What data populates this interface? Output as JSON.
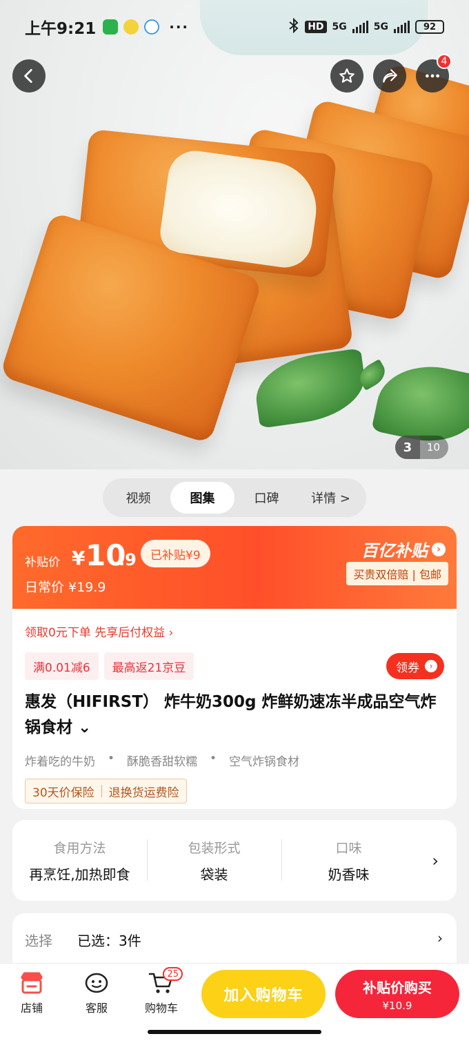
{
  "status_bar": {
    "time": "上午9:21",
    "network_hd": "HD",
    "network_5g_1": "5G",
    "network_5g_2": "5G",
    "battery": "92"
  },
  "gallery": {
    "current_index": "3",
    "total": "10",
    "more_badge": "4"
  },
  "tabs": [
    "视频",
    "图集",
    "口碑",
    "详情 >"
  ],
  "price": {
    "subsidy_label": "补贴价",
    "currency": "¥",
    "price_int": "10",
    "price_dec": ".9",
    "subsidized": "已补贴¥9",
    "regular": "日常价 ¥19.9",
    "brand": "百亿补贴",
    "perk": "买贵双倍赔 | 包邮"
  },
  "promo": {
    "pay_later": "领取0元下单 先享后付权益 ›",
    "tag1": "满0.01减6",
    "tag2": "最高返21京豆",
    "coupon": "领券"
  },
  "product": {
    "title": "惠发（HIFIRST） 炸牛奶300g 炸鲜奶速冻半成品空气炸锅食材 ⌄",
    "features": [
      "炸着吃的牛奶",
      "酥脆香甜软糯",
      "空气炸锅食材"
    ],
    "insurance": [
      "30天价保险",
      "退换货运费险"
    ]
  },
  "attributes": [
    {
      "key": "食用方法",
      "value": "再烹饪,加热即食"
    },
    {
      "key": "包装形式",
      "value": "袋装"
    },
    {
      "key": "口味",
      "value": "奶香味"
    }
  ],
  "selection": {
    "label": "选择",
    "value": "已选：3件"
  },
  "bottom_bar": {
    "store": "店铺",
    "service": "客服",
    "cart": "购物车",
    "cart_count": "25",
    "add_to_cart": "加入购物车",
    "buy_title": "补贴价购买",
    "buy_price": "¥10.9"
  },
  "colors": {
    "accent_red": "#f5263a",
    "accent_orange": "#ff5a2a",
    "accent_yellow": "#fcd116"
  }
}
